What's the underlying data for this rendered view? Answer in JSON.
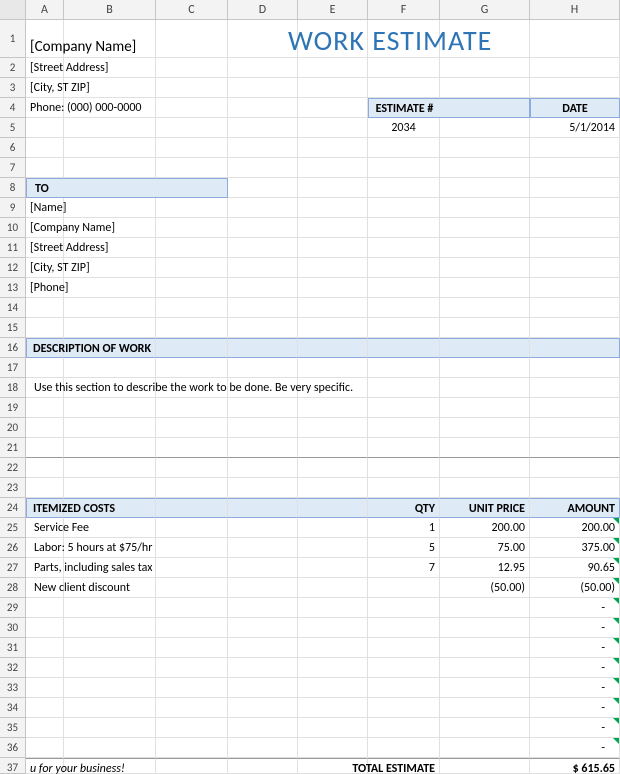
{
  "columns": [
    "A",
    "B",
    "C",
    "D",
    "E",
    "F",
    "G",
    "H"
  ],
  "rows": [
    "1",
    "2",
    "3",
    "4",
    "5",
    "6",
    "7",
    "8",
    "9",
    "10",
    "11",
    "12",
    "13",
    "14",
    "15",
    "16",
    "17",
    "18",
    "19",
    "20",
    "21",
    "22",
    "23",
    "24",
    "25",
    "26",
    "27",
    "28",
    "29",
    "30",
    "31",
    "32",
    "33",
    "34",
    "35",
    "36",
    "37"
  ],
  "header": {
    "company": "[Company Name]",
    "title": "WORK ESTIMATE",
    "street": "[Street Address]",
    "city": "[City, ST  ZIP]",
    "phone": "Phone: (000) 000-0000",
    "estimate_label": "ESTIMATE #",
    "date_label": "DATE",
    "estimate_num": "2034",
    "date_val": "5/1/2014"
  },
  "to": {
    "label": "TO",
    "name": "[Name]",
    "company": "[Company Name]",
    "street": "[Street Address]",
    "city": "[City, ST  ZIP]",
    "phone": "[Phone]"
  },
  "desc": {
    "label": "DESCRIPTION OF WORK",
    "text": "Use this section to describe the work to be done. Be very specific."
  },
  "items": {
    "hdr_label": "ITEMIZED COSTS",
    "hdr_qty": "QTY",
    "hdr_unit": "UNIT PRICE",
    "hdr_amt": "AMOUNT",
    "rows": [
      {
        "desc": "Service Fee",
        "qty": "1",
        "unit": "200.00",
        "amt": "200.00"
      },
      {
        "desc": "Labor: 5 hours at $75/hr",
        "qty": "5",
        "unit": "75.00",
        "amt": "375.00"
      },
      {
        "desc": "Parts, including sales tax",
        "qty": "7",
        "unit": "12.95",
        "amt": "90.65"
      },
      {
        "desc": "New client discount",
        "qty": "",
        "unit": "(50.00)",
        "amt": "(50.00)"
      }
    ],
    "empty_amt": "-"
  },
  "footer": {
    "thanks": "u for your business!",
    "total_label": "TOTAL ESTIMATE",
    "total_val": "$   615.65"
  }
}
